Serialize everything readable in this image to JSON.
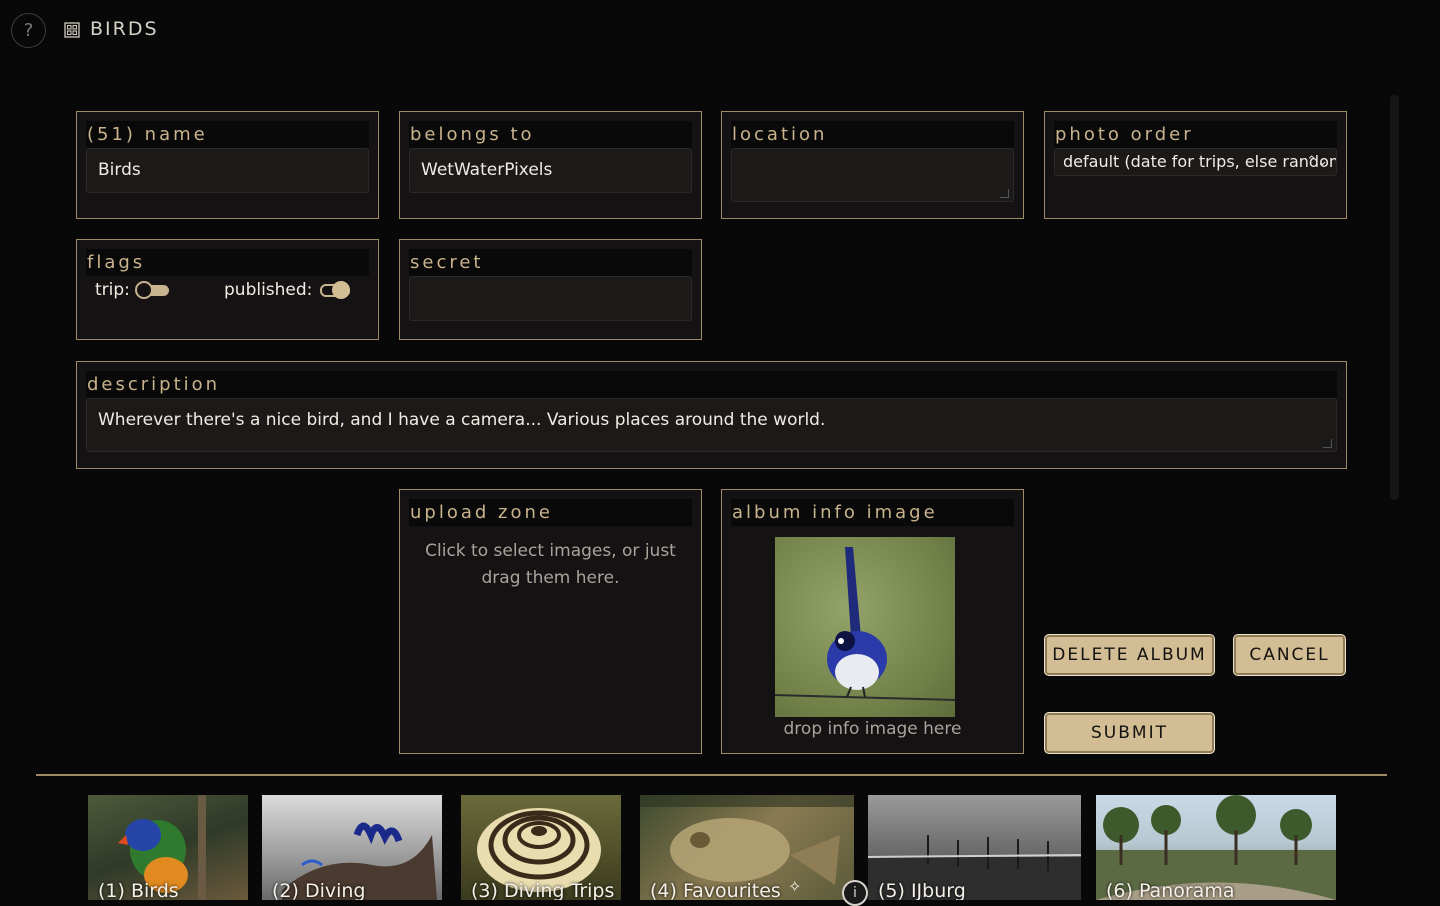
{
  "app": {
    "title": "BIRDS",
    "help_symbol": "?"
  },
  "form": {
    "name": {
      "label": "(51) name",
      "value": "Birds"
    },
    "belongs_to": {
      "label": "belongs to",
      "value": "WetWaterPixels"
    },
    "location": {
      "label": "location",
      "value": ""
    },
    "photo_order": {
      "label": "photo order",
      "selected": "default (date for trips, else random)"
    },
    "flags": {
      "label": "flags",
      "trip": {
        "label": "trip:",
        "on": false
      },
      "published": {
        "label": "published:",
        "on": true
      }
    },
    "secret": {
      "label": "secret",
      "value": ""
    },
    "description": {
      "label": "description",
      "value": "Wherever there's a nice bird, and I have a camera... Various places around the world."
    },
    "upload_zone": {
      "label": "upload zone",
      "hint": "Click to select images, or just drag them here."
    },
    "album_info_image": {
      "label": "album info image",
      "hint": "drop info image here"
    }
  },
  "buttons": {
    "delete_album": "DELETE ALBUM",
    "cancel": "CANCEL",
    "submit": "SUBMIT"
  },
  "albums": [
    {
      "label": "(1) Birds"
    },
    {
      "label": "(2) Diving"
    },
    {
      "label": "(3) Diving Trips"
    },
    {
      "label": "(4) Favourites"
    },
    {
      "label": "(5) IJburg"
    },
    {
      "label": "(6) Panorama"
    }
  ],
  "colors": {
    "accent": "#d2bd95",
    "panel_border": "#a08a66",
    "background": "#080808"
  }
}
